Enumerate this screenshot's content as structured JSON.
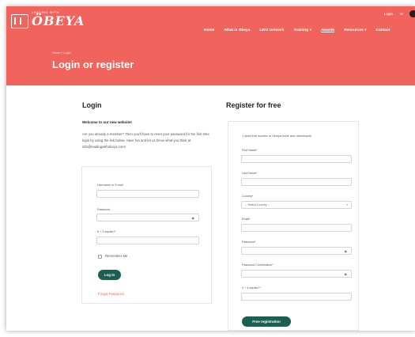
{
  "brand": {
    "tagline": "LEADING WITH",
    "name": "ÖBEYA"
  },
  "utility": {
    "login": "Login",
    "lang": "nl"
  },
  "nav": [
    "Home",
    "What is Obeya",
    "LWO Network",
    "Training ▾",
    "Awards",
    "Resources ▾",
    "Contact"
  ],
  "breadcrumb": "Home » Login",
  "page_title": "Login or register",
  "login": {
    "heading": "Login",
    "welcome": "Welcome to our new website!",
    "intro": "Are you already a member? Then you'll have to reset your password for the first time login by using the link below. Have fun and let us know what you think at info@leadingwithobeya.com!",
    "username_label": "Username or E-mail",
    "password_label": "Password",
    "captcha_label": "8 + 3 equals?*",
    "remember_label": "Remember Me",
    "login_button": "Log In",
    "forgot_link": "Forgot Password"
  },
  "register": {
    "heading": "Register for free",
    "intro": "1 year free access to Obeya tools and downloads.",
    "first_name_label": "First Name*",
    "last_name_label": "Last Name*",
    "country_label": "Country*",
    "country_value": "-- Select Country --",
    "email_label": "Email*",
    "password_label": "Password*",
    "password_confirm_label": "Password Confirmation*",
    "captcha_label": "9 + 4 equals?*",
    "submit_button": "Free registration"
  },
  "colors": {
    "brand": "#f1635d",
    "button": "#1b5e52"
  },
  "icons": {
    "password_toggle": "eye-icon",
    "country_select": "chevron-down-icon"
  }
}
